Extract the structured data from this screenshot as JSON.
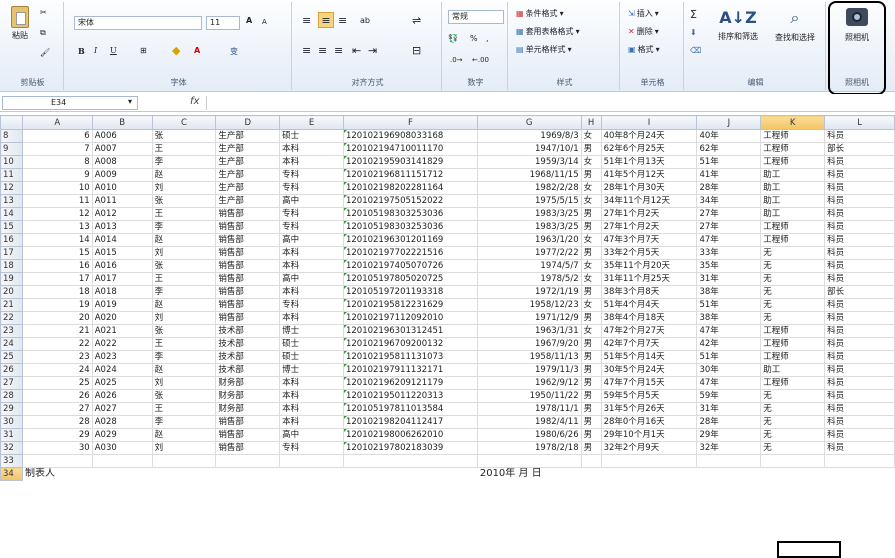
{
  "ribbon": {
    "clipboard": {
      "paste_label": "粘贴",
      "group_label": "剪贴板"
    },
    "font": {
      "font_name": "宋体",
      "font_size": "11",
      "group_label": "字体",
      "bold": "B",
      "italic": "I",
      "underline": "U",
      "grow": "A",
      "shrink": "A",
      "color_a": "A",
      "phonetic": "变"
    },
    "alignment": {
      "group_label": "对齐方式",
      "wrap": "ab"
    },
    "number": {
      "format": "常规",
      "percent": "%",
      "comma": ",",
      "group_label": "数字"
    },
    "styles": {
      "conditional": "条件格式",
      "table_format": "套用表格格式",
      "cell_style": "单元格样式",
      "group_label": "样式"
    },
    "cells": {
      "insert": "插入",
      "delete": "删除",
      "format": "格式",
      "group_label": "单元格"
    },
    "editing": {
      "sum": "Σ",
      "sort_filter": "排序和筛选",
      "find_select": "查找和选择",
      "group_label": "编辑"
    },
    "camera": {
      "label": "照相机",
      "group_label": "照相机"
    }
  },
  "formula_bar": {
    "name_box": "E34",
    "fx": "fx",
    "value": ""
  },
  "sheet": {
    "columns": [
      "A",
      "B",
      "C",
      "D",
      "E",
      "F",
      "G",
      "H",
      "I",
      "J",
      "K",
      "L"
    ],
    "selected_column": "K",
    "rows": [
      [
        "8",
        "6",
        "A006",
        "张",
        "生产部",
        "硕士",
        "120102196908033168",
        "1969/8/3",
        "女",
        "40年8个月24天",
        "40年",
        "工程师",
        "科员"
      ],
      [
        "9",
        "7",
        "A007",
        "王",
        "生产部",
        "本科",
        "120102194710011170",
        "1947/10/1",
        "男",
        "62年6个月25天",
        "62年",
        "工程师",
        "部长"
      ],
      [
        "10",
        "8",
        "A008",
        "李",
        "生产部",
        "本科",
        "120102195903141829",
        "1959/3/14",
        "女",
        "51年1个月13天",
        "51年",
        "工程师",
        "科员"
      ],
      [
        "11",
        "9",
        "A009",
        "赵",
        "生产部",
        "专科",
        "120102196811151712",
        "1968/11/15",
        "男",
        "41年5个月12天",
        "41年",
        "助工",
        "科员"
      ],
      [
        "12",
        "10",
        "A010",
        "刘",
        "生产部",
        "专科",
        "120102198202281164",
        "1982/2/28",
        "女",
        "28年1个月30天",
        "28年",
        "助工",
        "科员"
      ],
      [
        "13",
        "11",
        "A011",
        "张",
        "生产部",
        "高中",
        "120102197505152022",
        "1975/5/15",
        "女",
        "34年11个月12天",
        "34年",
        "助工",
        "科员"
      ],
      [
        "14",
        "12",
        "A012",
        "王",
        "销售部",
        "专科",
        "120105198303253036",
        "1983/3/25",
        "男",
        "27年1个月2天",
        "27年",
        "助工",
        "科员"
      ],
      [
        "15",
        "13",
        "A013",
        "李",
        "销售部",
        "专科",
        "120105198303253036",
        "1983/3/25",
        "男",
        "27年1个月2天",
        "27年",
        "工程师",
        "科员"
      ],
      [
        "16",
        "14",
        "A014",
        "赵",
        "销售部",
        "高中",
        "120102196301201169",
        "1963/1/20",
        "女",
        "47年3个月7天",
        "47年",
        "工程师",
        "科员"
      ],
      [
        "17",
        "15",
        "A015",
        "刘",
        "销售部",
        "本科",
        "120102197702221516",
        "1977/2/22",
        "男",
        "33年2个月5天",
        "33年",
        "无",
        "科员"
      ],
      [
        "18",
        "16",
        "A016",
        "张",
        "销售部",
        "本科",
        "120102197405070726",
        "1974/5/7",
        "女",
        "35年11个月20天",
        "35年",
        "无",
        "科员"
      ],
      [
        "19",
        "17",
        "A017",
        "王",
        "销售部",
        "高中",
        "120105197805020725",
        "1978/5/2",
        "女",
        "31年11个月25天",
        "31年",
        "无",
        "科员"
      ],
      [
        "20",
        "18",
        "A018",
        "李",
        "销售部",
        "本科",
        "120105197201193318",
        "1972/1/19",
        "男",
        "38年3个月8天",
        "38年",
        "无",
        "部长"
      ],
      [
        "21",
        "19",
        "A019",
        "赵",
        "销售部",
        "专科",
        "120102195812231629",
        "1958/12/23",
        "女",
        "51年4个月4天",
        "51年",
        "无",
        "科员"
      ],
      [
        "22",
        "20",
        "A020",
        "刘",
        "销售部",
        "本科",
        "120102197112092010",
        "1971/12/9",
        "男",
        "38年4个月18天",
        "38年",
        "无",
        "科员"
      ],
      [
        "23",
        "21",
        "A021",
        "张",
        "技术部",
        "博士",
        "120102196301312451",
        "1963/1/31",
        "女",
        "47年2个月27天",
        "47年",
        "工程师",
        "科员"
      ],
      [
        "24",
        "22",
        "A022",
        "王",
        "技术部",
        "硕士",
        "120102196709200132",
        "1967/9/20",
        "男",
        "42年7个月7天",
        "42年",
        "工程师",
        "科员"
      ],
      [
        "25",
        "23",
        "A023",
        "李",
        "技术部",
        "硕士",
        "120102195811131073",
        "1958/11/13",
        "男",
        "51年5个月14天",
        "51年",
        "工程师",
        "科员"
      ],
      [
        "26",
        "24",
        "A024",
        "赵",
        "技术部",
        "博士",
        "120102197911132171",
        "1979/11/3",
        "男",
        "30年5个月24天",
        "30年",
        "助工",
        "科员"
      ],
      [
        "27",
        "25",
        "A025",
        "刘",
        "财务部",
        "本科",
        "120102196209121179",
        "1962/9/12",
        "男",
        "47年7个月15天",
        "47年",
        "工程师",
        "科员"
      ],
      [
        "28",
        "26",
        "A026",
        "张",
        "财务部",
        "本科",
        "120102195011220313",
        "1950/11/22",
        "男",
        "59年5个月5天",
        "59年",
        "无",
        "科员"
      ],
      [
        "29",
        "27",
        "A027",
        "王",
        "财务部",
        "本科",
        "120105197811013584",
        "1978/11/1",
        "男",
        "31年5个月26天",
        "31年",
        "无",
        "科员"
      ],
      [
        "30",
        "28",
        "A028",
        "李",
        "销售部",
        "本科",
        "120102198204112417",
        "1982/4/11",
        "男",
        "28年0个月16天",
        "28年",
        "无",
        "科员"
      ],
      [
        "31",
        "29",
        "A029",
        "赵",
        "销售部",
        "高中",
        "120102198006262010",
        "1980/6/26",
        "男",
        "29年10个月1天",
        "29年",
        "无",
        "科员"
      ],
      [
        "32",
        "30",
        "A030",
        "刘",
        "销售部",
        "专科",
        "120102197802183039",
        "1978/2/18",
        "男",
        "32年2个月9天",
        "32年",
        "无",
        "科员"
      ],
      [
        "33",
        "",
        "",
        "",
        "",
        "",
        "",
        "",
        "",
        "",
        "",
        "",
        ""
      ]
    ],
    "footer": {
      "row": "34",
      "label": "制表人",
      "date_label": "2010年 月 日"
    }
  }
}
